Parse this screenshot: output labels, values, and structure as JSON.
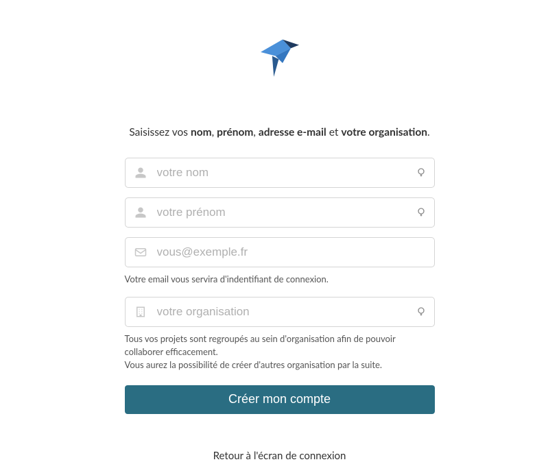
{
  "intro": {
    "prefix": "Saisissez vos ",
    "bold1": "nom",
    "sep1": ", ",
    "bold2": "prénom",
    "sep2": ", ",
    "bold3": "adresse e-mail",
    "sep3": " et ",
    "bold4": "votre organisation",
    "suffix": "."
  },
  "fields": {
    "lastname": {
      "placeholder": "votre nom",
      "value": ""
    },
    "firstname": {
      "placeholder": "votre prénom",
      "value": ""
    },
    "email": {
      "placeholder": "vous@exemple.fr",
      "value": ""
    },
    "organisation": {
      "placeholder": "votre organisation",
      "value": ""
    }
  },
  "hints": {
    "email": "Votre email vous servira d'indentifiant de connexion.",
    "org_line1": "Tous vos projets sont regroupés au sein d'organisation afin de pouvoir collaborer efficacement.",
    "org_line2": "Vous aurez la possibilité de créer d'autres organisation par la suite."
  },
  "actions": {
    "submit_label": "Créer mon compte",
    "back_label": "Retour à l'écran de connexion"
  },
  "colors": {
    "accent": "#2a6d82",
    "logo_primary": "#3b82d6",
    "logo_dark": "#1e3a5f"
  }
}
